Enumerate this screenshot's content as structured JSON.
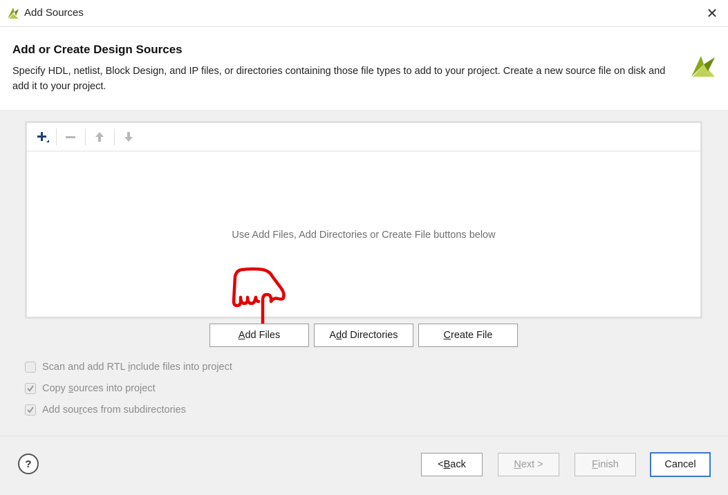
{
  "window": {
    "title": "Add Sources",
    "close_glyph": "✕"
  },
  "header": {
    "title": "Add or Create Design Sources",
    "description": "Specify HDL, netlist, Block Design, and IP files, or directories containing those file types to add to your project. Create a new source file on disk and add it to your project."
  },
  "file_panel": {
    "toolbar": [
      {
        "name": "add-icon",
        "enabled": true
      },
      {
        "name": "remove-icon",
        "enabled": false
      },
      {
        "name": "move-up-icon",
        "enabled": false
      },
      {
        "name": "move-down-icon",
        "enabled": false
      }
    ],
    "empty_message": "Use Add Files, Add Directories or Create File buttons below"
  },
  "actions": {
    "add_files": {
      "pre": "",
      "mnemonic": "A",
      "post": "dd Files"
    },
    "add_directories": {
      "pre": "A",
      "mnemonic": "d",
      "post": "d Directories"
    },
    "create_file": {
      "pre": "",
      "mnemonic": "C",
      "post": "reate File"
    }
  },
  "options": [
    {
      "pre": "Scan and add RTL ",
      "mnemonic": "i",
      "post": "nclude files into project",
      "checked": false,
      "enabled": false
    },
    {
      "pre": "Copy ",
      "mnemonic": "s",
      "post": "ources into project",
      "checked": true,
      "enabled": false
    },
    {
      "pre": "Add sou",
      "mnemonic": "r",
      "post": "ces from subdirectories",
      "checked": true,
      "enabled": false
    }
  ],
  "footer": {
    "help": "?",
    "back": {
      "pre": "< ",
      "mnemonic": "B",
      "post": "ack",
      "enabled": true
    },
    "next": {
      "pre": "",
      "mnemonic": "N",
      "post": "ext >",
      "enabled": false
    },
    "finish": {
      "pre": "",
      "mnemonic": "F",
      "post": "inish",
      "enabled": false
    },
    "cancel": {
      "label": "Cancel",
      "enabled": true
    }
  },
  "colors": {
    "annotation": "#e30000",
    "logo": "#8aa61c",
    "primary_border": "#3b78c9"
  }
}
